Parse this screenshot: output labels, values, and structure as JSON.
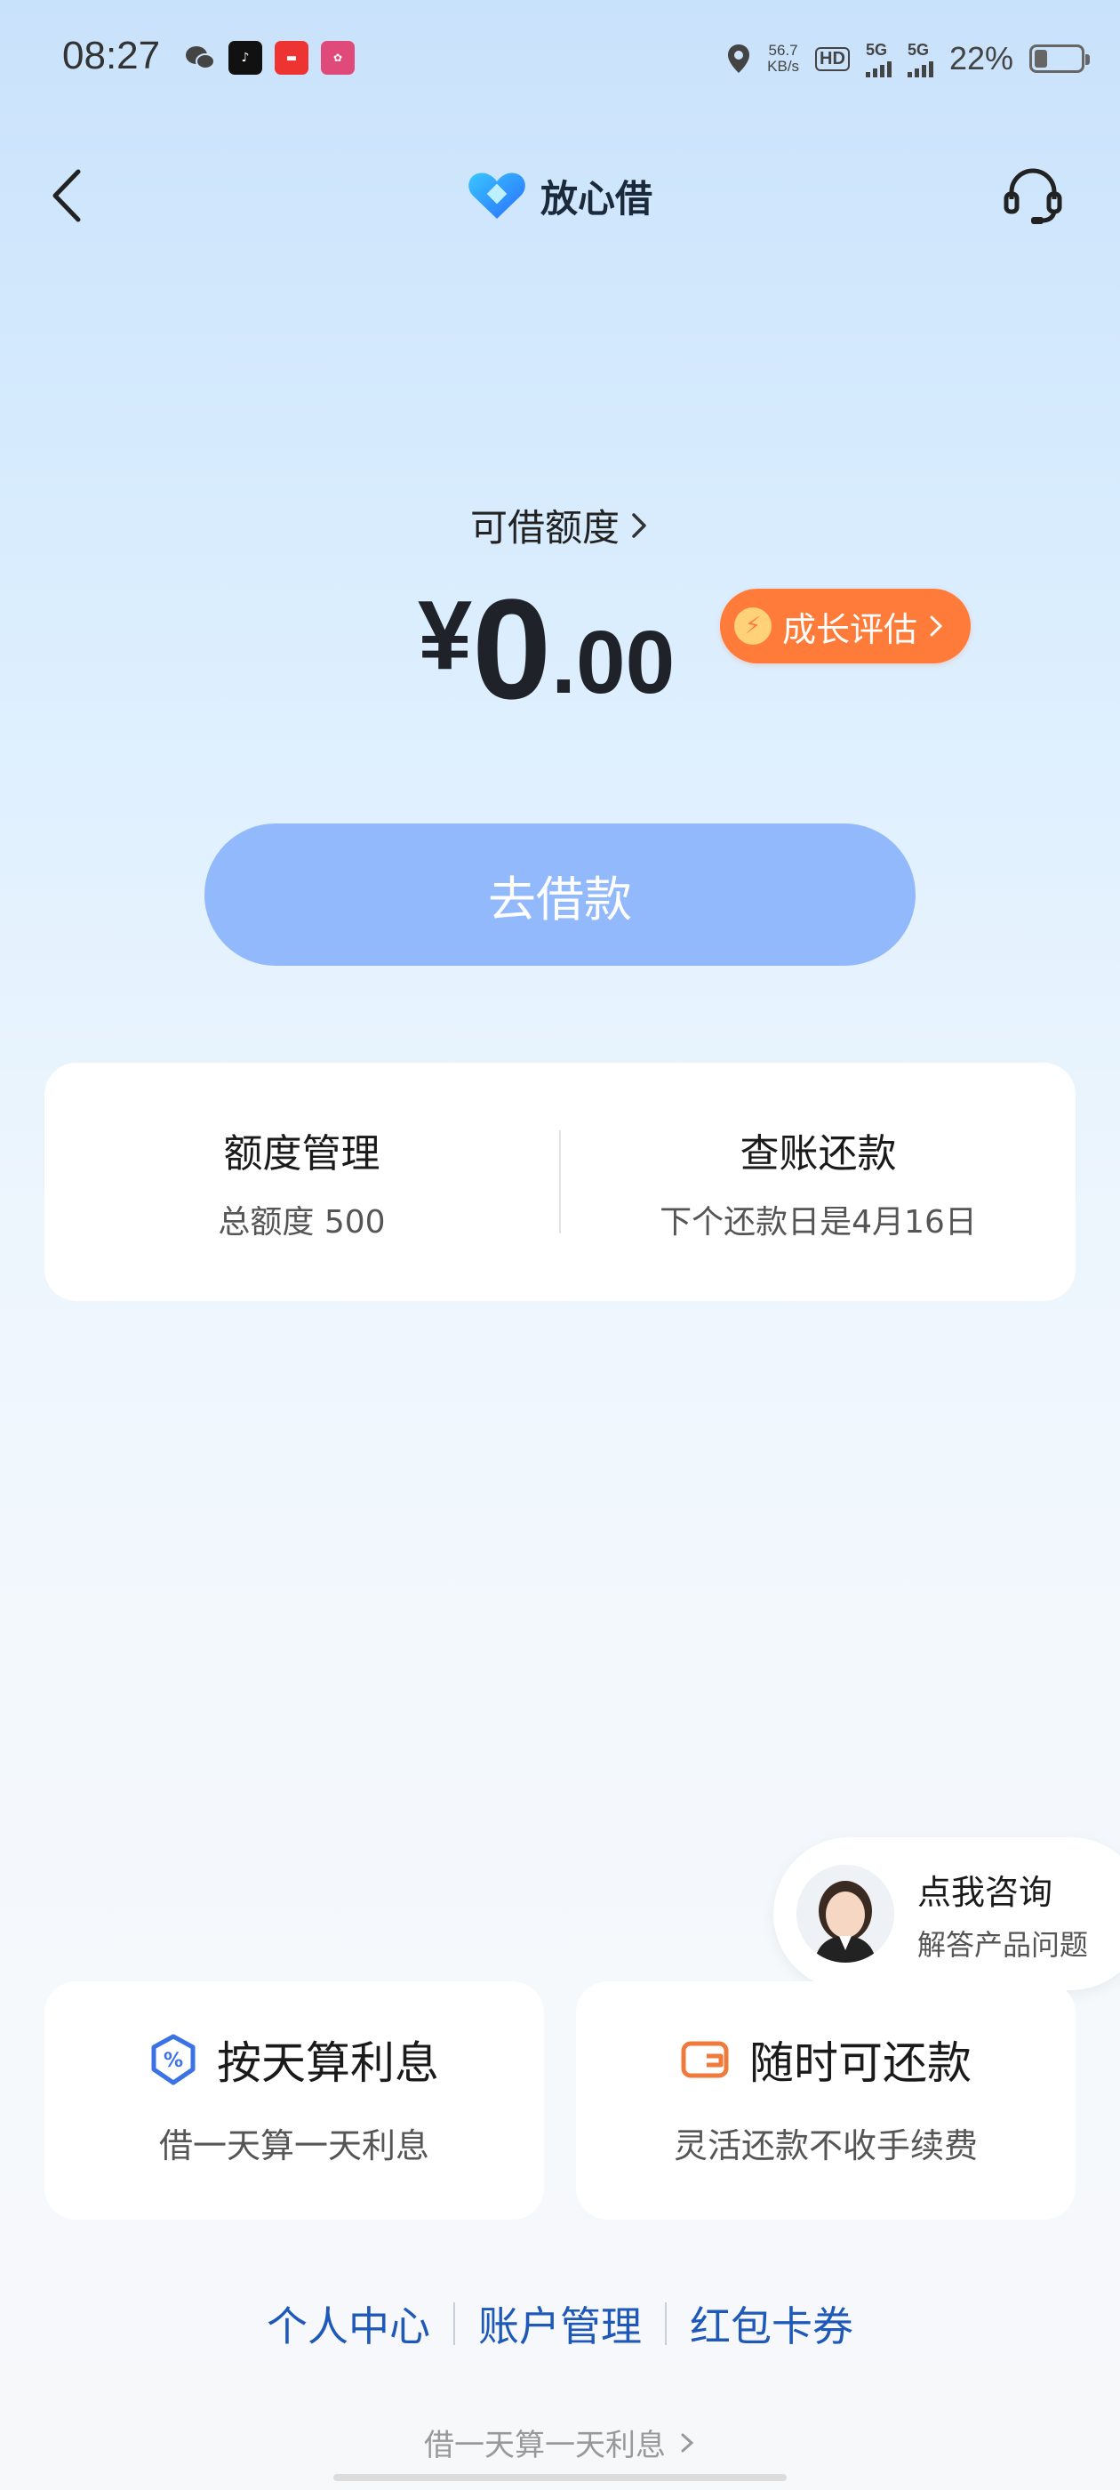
{
  "status_bar": {
    "time": "08:27",
    "net_speed_value": "56.7",
    "net_speed_unit": "KB/s",
    "hd": "HD",
    "sim1": "5G",
    "sim2": "5G",
    "battery_pct": "22%",
    "notification_icons": [
      "wechat-icon",
      "douyin-icon",
      "toutiao-icon",
      "lala-icon"
    ]
  },
  "header": {
    "brand_name": "放心借"
  },
  "credit": {
    "label": "可借额度",
    "currency": "¥",
    "amount_integer": "0",
    "amount_decimal": ".00",
    "growth_label": "成长评估"
  },
  "borrow_button": "去借款",
  "management": {
    "quota_title": "额度管理",
    "quota_sub": "总额度 500",
    "repay_title": "查账还款",
    "repay_sub": "下个还款日是4月16日"
  },
  "consult": {
    "title": "点我咨询",
    "sub": "解答产品问题"
  },
  "features": [
    {
      "title": "按天算利息",
      "sub": "借一天算一天利息",
      "icon": "percent-shield-icon",
      "color": "#3b73e6"
    },
    {
      "title": "随时可还款",
      "sub": "灵活还款不收手续费",
      "icon": "wallet-icon",
      "color": "#f07a3c"
    }
  ],
  "links": [
    "个人中心",
    "账户管理",
    "红包卡券"
  ],
  "ticker": "借一天算一天利息",
  "colors": {
    "accent": "#92b9fb",
    "growth": "#ff7b3a",
    "link": "#1e58b8"
  }
}
